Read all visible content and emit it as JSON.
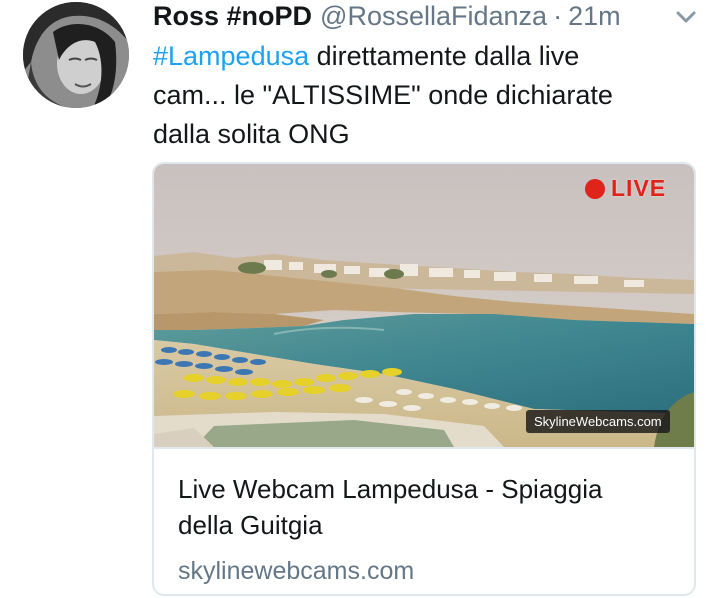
{
  "tweet": {
    "display_name": "Ross #noPD",
    "handle": "@RossellaFidanza",
    "separator": "·",
    "timestamp": "21m",
    "caret_icon": "chevron-down-icon",
    "text": {
      "hashtag": "#Lampedusa",
      "line1_rest": " direttamente dalla live",
      "line2": "cam... le \"ALTISSIME\" onde dichiarate",
      "line3": "dalla solita ONG"
    }
  },
  "card": {
    "live_label": "LIVE",
    "watermark": "SkylineWebcams.com",
    "title_line1": "Live Webcam Lampedusa - Spiaggia",
    "title_line2": "della Guitgia",
    "domain": "skylinewebcams.com"
  },
  "colors": {
    "link": "#1da1f2",
    "text": "#14171a",
    "muted": "#657786",
    "live": "#e0241b",
    "border": "#e1e8ed"
  }
}
